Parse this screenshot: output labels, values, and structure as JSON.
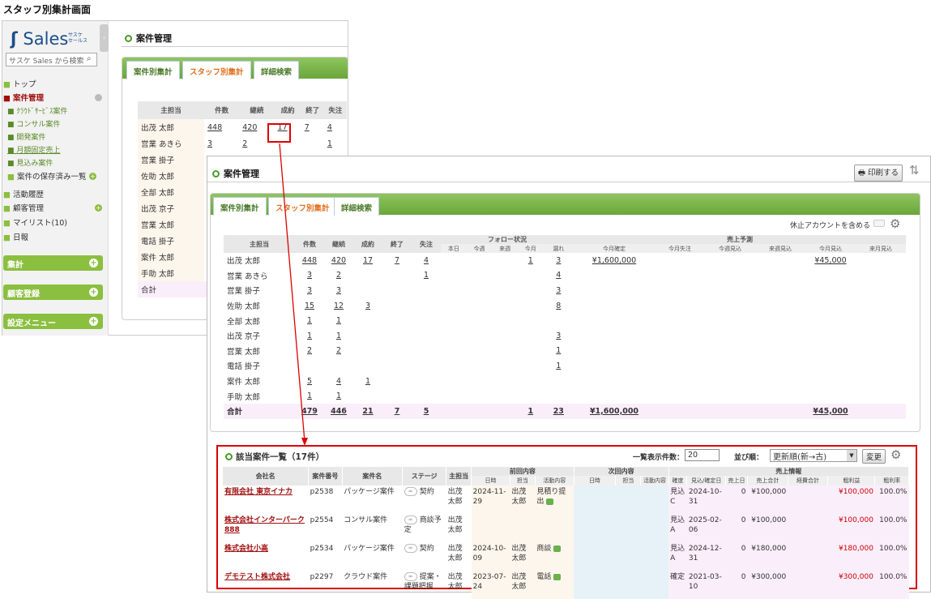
{
  "heading": "スタッフ別集計画面",
  "sidebar": {
    "logo": "Sales",
    "logo_sub1": "サスケ",
    "logo_sub2": "セールス",
    "search_placeholder": "サスケ Sales から検索",
    "items": [
      "トップ",
      "案件管理",
      "ｸﾗｳﾄﾞｻｰﾋﾞｽ案件",
      "コンサル案件",
      "開発案件",
      "月額固定売上",
      "見込み案件",
      "案件の保存済み一覧",
      "活動履歴",
      "顧客管理",
      "マイリスト(10)",
      "日報"
    ],
    "bars": [
      "集計",
      "顧客登録",
      "設定メニュー"
    ]
  },
  "page_title": "案件管理",
  "tabs": [
    "案件別集計",
    "スタッフ別集計",
    "詳細検索"
  ],
  "back_table": {
    "headers": [
      "主担当",
      "件数",
      "継続",
      "成約",
      "終了",
      "失注"
    ],
    "rows": [
      [
        "出茂 太郎",
        "448",
        "420",
        "17",
        "7",
        "4"
      ],
      [
        "営業 あきら",
        "3",
        "2",
        "",
        "",
        "1"
      ],
      [
        "営業 掛子"
      ],
      [
        "佐助 太郎"
      ],
      [
        "全部 太郎"
      ],
      [
        "出茂 京子"
      ],
      [
        "営業 太郎"
      ],
      [
        "電話 掛子"
      ],
      [
        "案件 太郎"
      ],
      [
        "手助 太郎"
      ],
      [
        "合計"
      ]
    ]
  },
  "front": {
    "title": "案件管理",
    "print_label": "印刷する",
    "inactive_label": "休止アカウントを含める",
    "headers": {
      "staff": "主担当",
      "count": "件数",
      "cont": "継続",
      "won": "成約",
      "end": "終了",
      "lost": "失注",
      "follow": "フォロー状況",
      "forecast": "売上予測"
    },
    "follow_sub": [
      "本日",
      "今週",
      "来週",
      "今月",
      "漏れ"
    ],
    "forecast_sub": [
      "今月確定",
      "今月失注",
      "今週見込",
      "来週見込",
      "今月見込",
      "来月見込"
    ],
    "rows": [
      [
        "出茂 太郎",
        "448",
        "420",
        "17",
        "7",
        "4",
        "",
        "",
        "",
        "1",
        "3",
        "¥1,600,000",
        "",
        "",
        "",
        "¥45,000",
        ""
      ],
      [
        "営業 あきら",
        "3",
        "2",
        "",
        "",
        "1",
        "",
        "",
        "",
        "",
        "4",
        "",
        "",
        "",
        "",
        "",
        ""
      ],
      [
        "営業 掛子",
        "3",
        "3",
        "",
        "",
        "",
        "",
        "",
        "",
        "",
        "3",
        "",
        "",
        "",
        "",
        "",
        ""
      ],
      [
        "佐助 太郎",
        "15",
        "12",
        "3",
        "",
        "",
        "",
        "",
        "",
        "",
        "8",
        "",
        "",
        "",
        "",
        "",
        ""
      ],
      [
        "全部 太郎",
        "1",
        "1",
        "",
        "",
        "",
        "",
        "",
        "",
        "",
        "",
        "",
        "",
        "",
        "",
        "",
        ""
      ],
      [
        "出茂 京子",
        "1",
        "1",
        "",
        "",
        "",
        "",
        "",
        "",
        "",
        "3",
        "",
        "",
        "",
        "",
        "",
        ""
      ],
      [
        "営業 太郎",
        "2",
        "2",
        "",
        "",
        "",
        "",
        "",
        "",
        "",
        "1",
        "",
        "",
        "",
        "",
        "",
        ""
      ],
      [
        "電話 掛子",
        "",
        "",
        "",
        "",
        "",
        "",
        "",
        "",
        "",
        "1",
        "",
        "",
        "",
        "",
        "",
        ""
      ],
      [
        "案件 太郎",
        "5",
        "4",
        "1",
        "",
        "",
        "",
        "",
        "",
        "",
        "",
        "",
        "",
        "",
        "",
        "",
        ""
      ],
      [
        "手助 太郎",
        "1",
        "1",
        "",
        "",
        "",
        "",
        "",
        "",
        "",
        "",
        "",
        "",
        "",
        "",
        "",
        ""
      ]
    ],
    "total": [
      "合計",
      "479",
      "446",
      "21",
      "7",
      "5",
      "",
      "",
      "",
      "1",
      "23",
      "¥1,600,000",
      "",
      "",
      "",
      "¥45,000",
      ""
    ]
  },
  "list": {
    "title": "該当案件一覧（17件）",
    "count_label": "一覧表示件数：",
    "count_value": "20",
    "sort_label": "並び順：",
    "sort_value": "更新順(新→古)",
    "change_btn": "変更",
    "headers": {
      "company": "会社名",
      "no": "案件番号",
      "name": "案件名",
      "stage": "ステージ",
      "staff": "主担当",
      "prev": "前回内容",
      "next": "次回内容",
      "sales": "売上情報"
    },
    "prev_sub": [
      "日時",
      "担当",
      "活動内容"
    ],
    "next_sub": [
      "日時",
      "担当",
      "活動内容"
    ],
    "sales_sub": [
      "確度",
      "見込/確定日",
      "売上日",
      "売上合計",
      "経費合計",
      "粗利益",
      "粗利率"
    ],
    "rows": [
      {
        "company": "有限会社 東京イナカ",
        "no": "p2538",
        "name": "パッケージ案件",
        "stage": "契約",
        "staff": "出茂 太郎",
        "pdate": "2024-11-29",
        "pstaff": "出茂 太郎",
        "pact": "見積り提出",
        "conf": "見込C",
        "date": "2024-10-31",
        "sday": "0",
        "total": "¥100,000",
        "profit": "¥100,000",
        "rate": "100.0%"
      },
      {
        "company": "株式会社インターパーク888",
        "no": "p2554",
        "name": "コンサル案件",
        "stage": "商談予定",
        "staff": "出茂 太郎",
        "pdate": "",
        "pstaff": "",
        "pact": "",
        "conf": "見込A",
        "date": "2025-02-06",
        "sday": "0",
        "total": "¥100,000",
        "profit": "¥100,000",
        "rate": "100.0%"
      },
      {
        "company": "株式会社小高",
        "no": "p2534",
        "name": "パッケージ案件",
        "stage": "契約",
        "staff": "出茂 太郎",
        "pdate": "2024-10-09",
        "pstaff": "出茂 太郎",
        "pact": "商談",
        "conf": "見込A",
        "date": "2024-12-31",
        "sday": "0",
        "total": "¥180,000",
        "profit": "¥180,000",
        "rate": "100.0%"
      },
      {
        "company": "デモテスト株式会社",
        "no": "p2297",
        "name": "クラウド案件",
        "stage": "提案・課題把握",
        "staff": "出茂 太郎",
        "pdate": "2023-07-24",
        "pstaff": "出茂 太郎",
        "pact": "電話",
        "conf": "確定",
        "date": "2021-03-10",
        "sday": "0",
        "total": "¥300,000",
        "profit": "¥300,000",
        "rate": "100.0%"
      }
    ]
  },
  "colors": {
    "accent": "#8bbf3f",
    "highlight": "#dd0000",
    "link": "#a01010"
  }
}
